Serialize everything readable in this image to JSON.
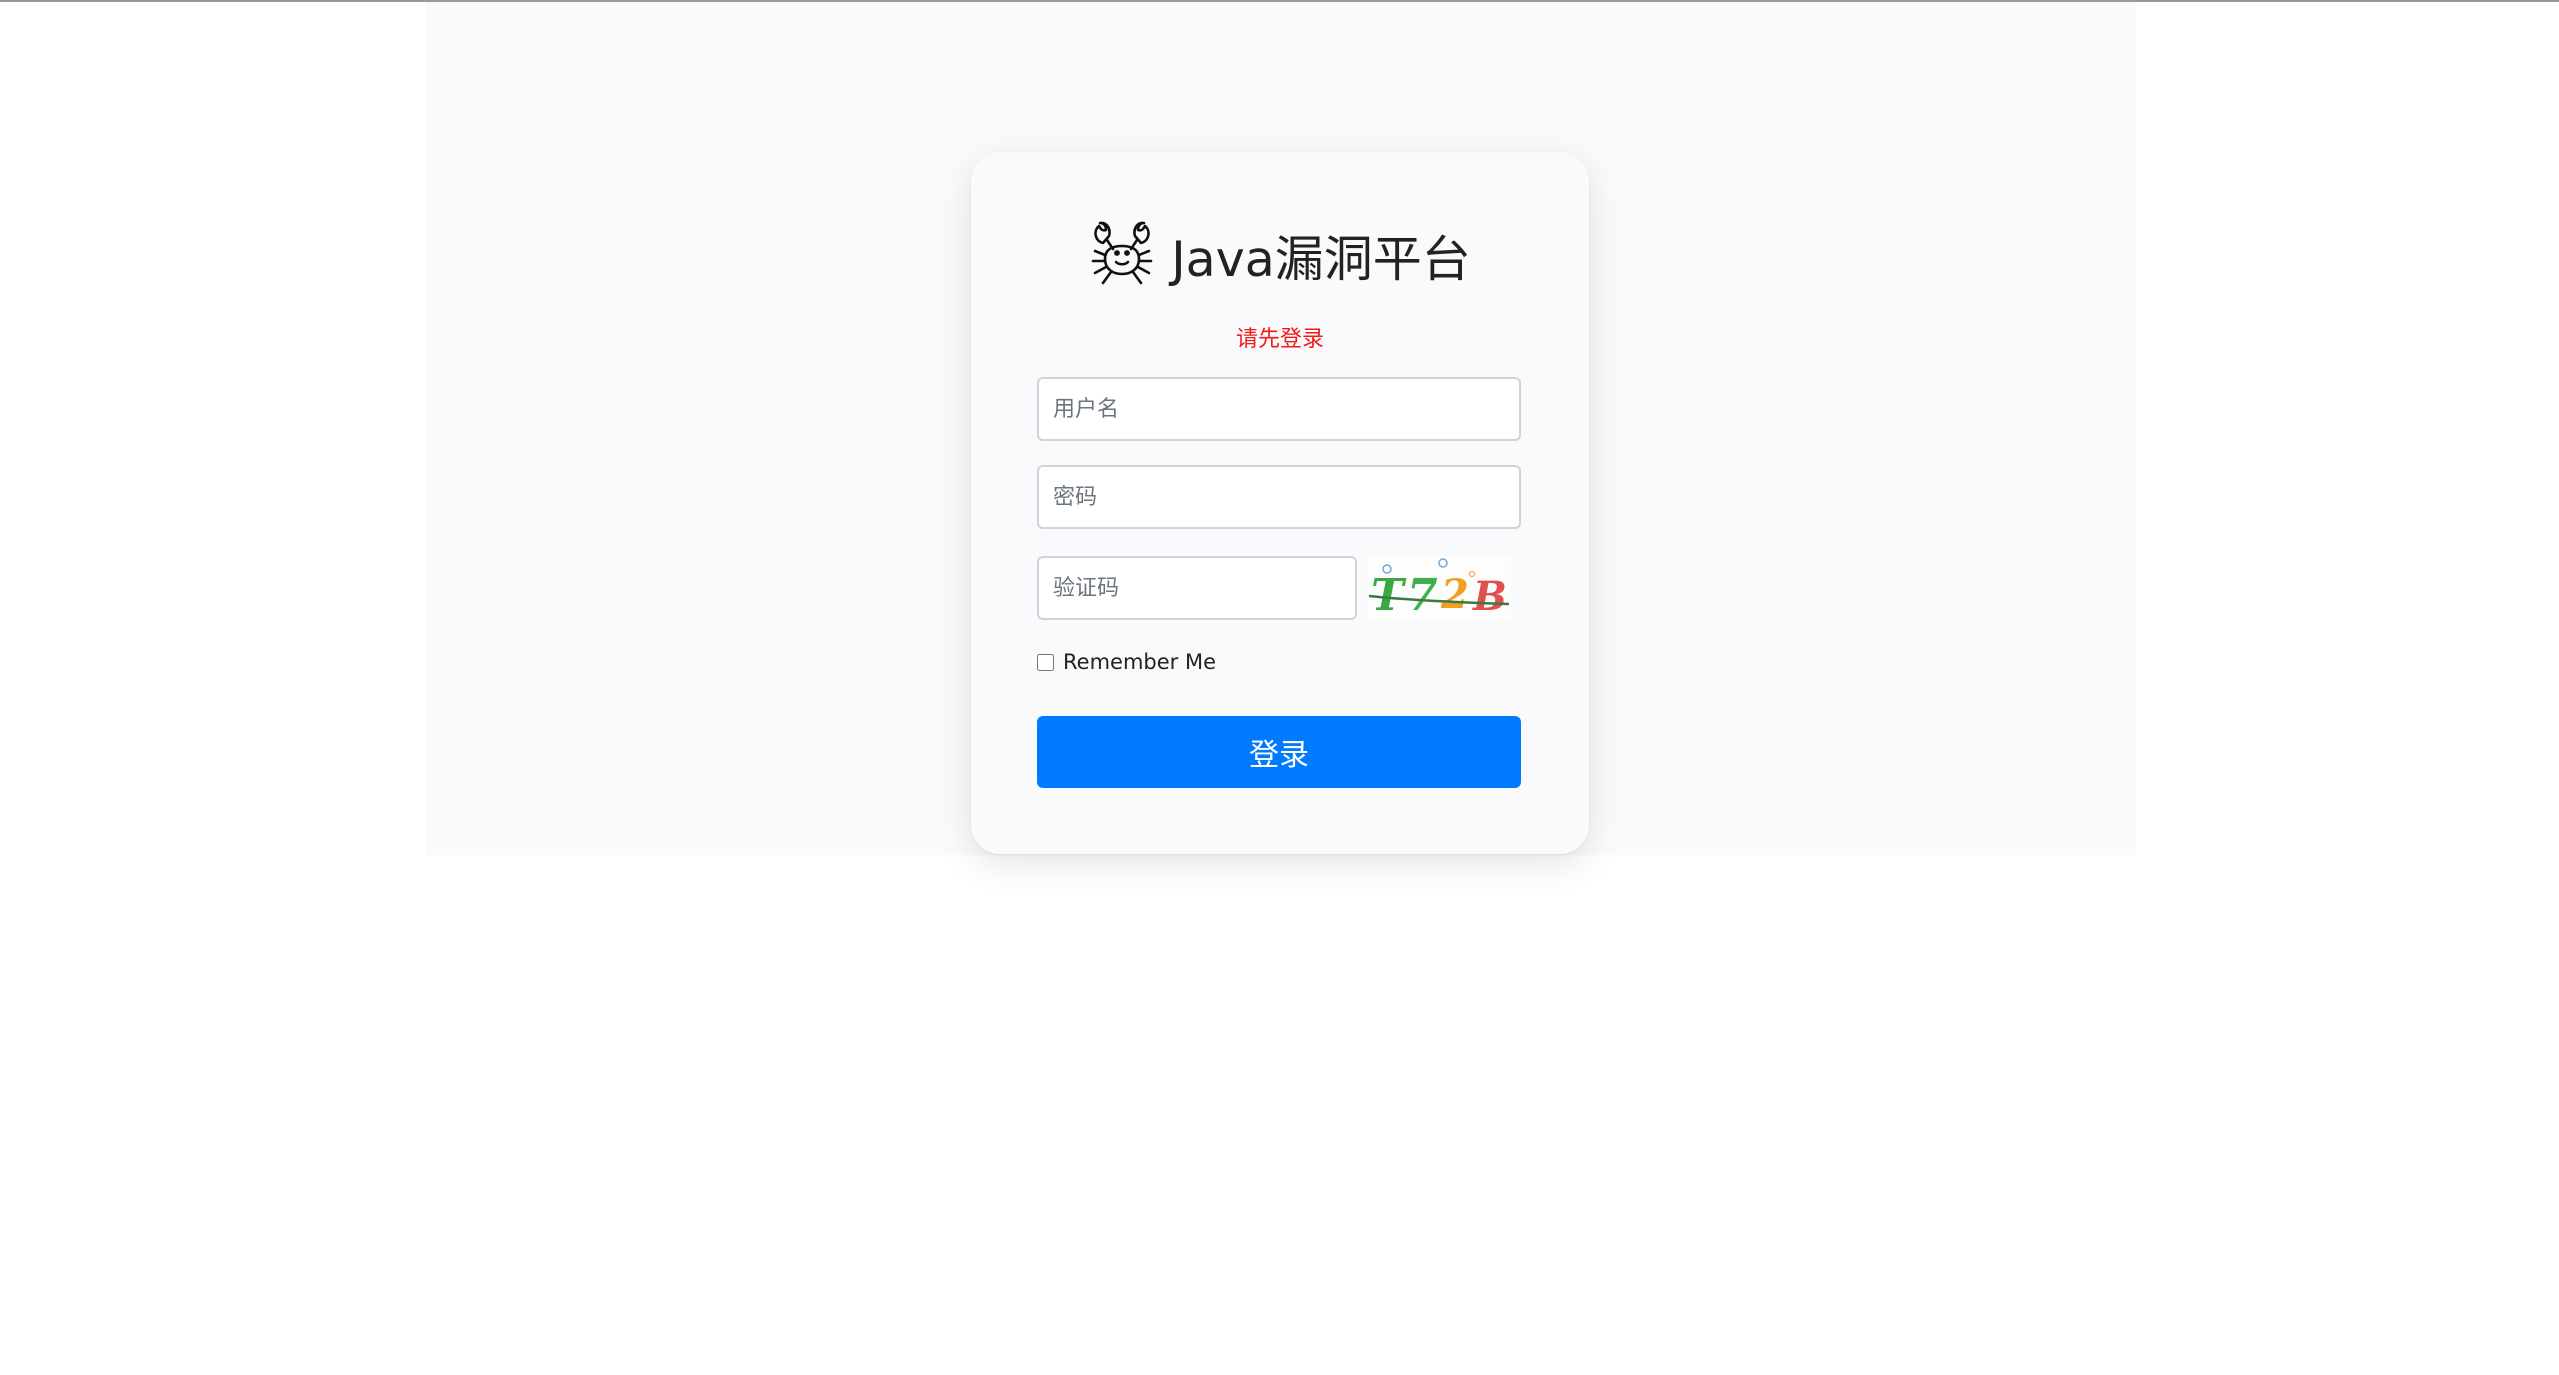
{
  "app": {
    "title": "Java漏洞平台",
    "logo_icon": "crab-icon"
  },
  "login": {
    "notice": "请先登录",
    "username_placeholder": "用户名",
    "password_placeholder": "密码",
    "captcha_placeholder": "验证码",
    "captcha_text": "T72B",
    "remember_label": "Remember Me",
    "submit_label": "登录"
  },
  "colors": {
    "primary": "#007bff",
    "notice": "#f21a1a",
    "background": "#f9fafc"
  }
}
